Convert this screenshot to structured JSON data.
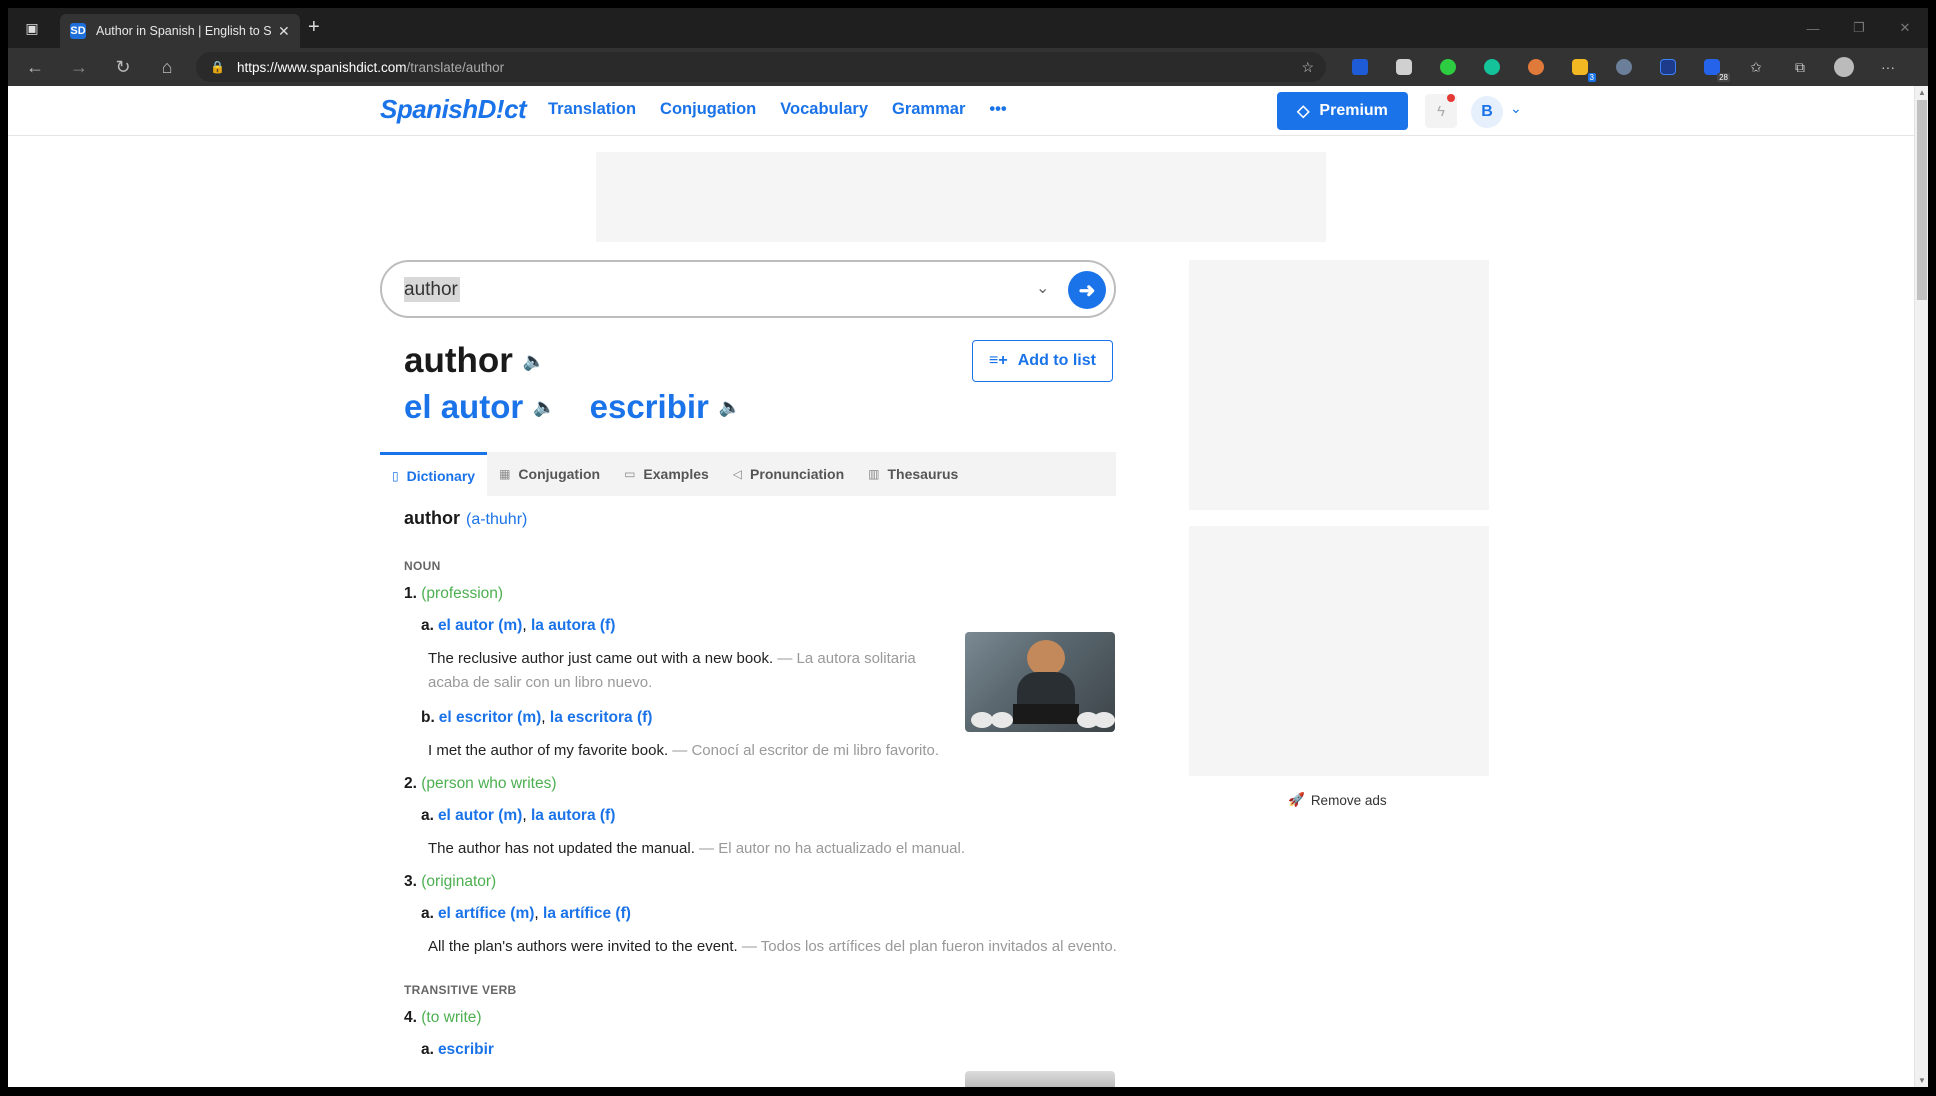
{
  "browser": {
    "tab_title": "Author in Spanish | English to Spanish Translation",
    "tab_favicon": "SD",
    "url_host": "https://www.spanishdict.com",
    "url_path": "/translate/author",
    "ext_badges": [
      "3",
      "28"
    ]
  },
  "site": {
    "logo": "SpanishD!ct",
    "nav": [
      "Translation",
      "Conjugation",
      "Vocabulary",
      "Grammar",
      "•••"
    ],
    "premium_label": "Premium",
    "avatar_initial": "B",
    "remove_ads": "Remove ads"
  },
  "search": {
    "value": "author"
  },
  "headword": {
    "word": "author",
    "translations": [
      "el autor",
      "escribir"
    ],
    "add_to_list": "Add to list"
  },
  "tabs": [
    {
      "label": "Dictionary",
      "icon": "book-icon"
    },
    {
      "label": "Conjugation",
      "icon": "table-icon"
    },
    {
      "label": "Examples",
      "icon": "chat-icon"
    },
    {
      "label": "Pronunciation",
      "icon": "speaker-icon"
    },
    {
      "label": "Thesaurus",
      "icon": "open-book-icon"
    }
  ],
  "entry": {
    "head": "author",
    "pron": "(a-thuhr)",
    "noun_label": "NOUN",
    "verb_label": "TRANSITIVE VERB",
    "s1": {
      "num": "1.",
      "ctx": "(profession)",
      "a_label": "a.",
      "a_w1": "el autor (m)",
      "a_w2": "la autora (f)",
      "a_en": "The reclusive author just came out with a new book.",
      "a_es": "La autora solitaria acaba de salir con un libro nuevo.",
      "b_label": "b.",
      "b_w1": "el escritor (m)",
      "b_w2": "la escritora (f)",
      "b_en": "I met the author of my favorite book.",
      "b_es": "Conocí al escritor de mi libro favorito."
    },
    "s2": {
      "num": "2.",
      "ctx": "(person who writes)",
      "a_label": "a.",
      "a_w1": "el autor (m)",
      "a_w2": "la autora (f)",
      "a_en": "The author has not updated the manual.",
      "a_es": "El autor no ha actualizado el manual."
    },
    "s3": {
      "num": "3.",
      "ctx": "(originator)",
      "a_label": "a.",
      "a_w1": "el artífice (m)",
      "a_w2": "la artífice (f)",
      "a_en": "All the plan's authors were invited to the event.",
      "a_es": "Todos los artífices del plan fueron invitados al evento."
    },
    "s4": {
      "num": "4.",
      "ctx": "(to write)",
      "a_label": "a.",
      "a_w1": "escribir"
    }
  },
  "colors": {
    "accent": "#1a73e8",
    "context_green": "#4caf50"
  }
}
